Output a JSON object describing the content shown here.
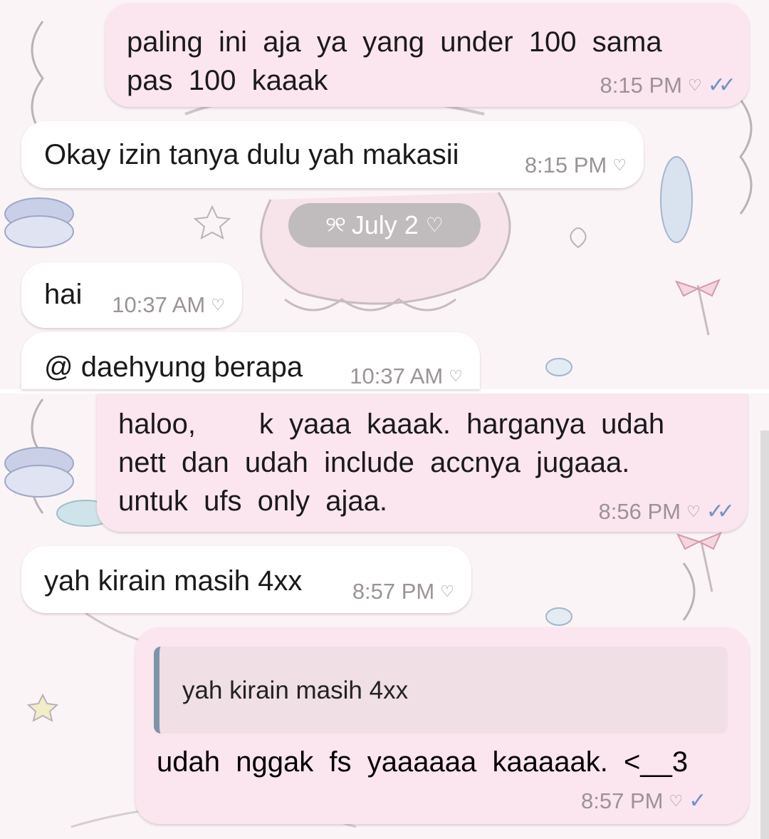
{
  "date_chip": {
    "text": "July 2",
    "deco": "୨୧"
  },
  "messages": [
    {
      "id": "m1",
      "direction": "outgoing",
      "lines": [
        "paling  ini  aja  ya  yang  under  100  sama",
        "pas  100  kaaak"
      ],
      "time": "8:15 PM",
      "status": "read"
    },
    {
      "id": "m2",
      "direction": "incoming",
      "lines": [
        "Okay izin tanya dulu yah makasii"
      ],
      "time": "8:15 PM"
    },
    {
      "id": "m3",
      "direction": "incoming",
      "lines": [
        "hai"
      ],
      "time": "10:37 AM"
    },
    {
      "id": "m4",
      "direction": "incoming",
      "lines": [
        "@ daehyung berapa"
      ],
      "time": "10:37 AM"
    },
    {
      "id": "m5",
      "direction": "outgoing",
      "lines": [
        "haloo,        k  yaaa  kaaak.  harganya  udah",
        "nett  dan  udah  include  accnya  jugaaa.",
        "untuk  ufs  only  ajaa."
      ],
      "time": "8:56 PM",
      "status": "read"
    },
    {
      "id": "m6",
      "direction": "incoming",
      "lines": [
        "yah kirain masih 4xx"
      ],
      "time": "8:57 PM"
    },
    {
      "id": "m7",
      "direction": "outgoing",
      "reply_to": "yah kirain masih 4xx",
      "lines": [
        "udah  nggak  fs  yaaaaaa  kaaaaak.  <__3"
      ],
      "time": "8:57 PM",
      "status": "sent"
    }
  ],
  "icons": {
    "heart": "heart-outline-icon",
    "read": "double-check-icon",
    "sent": "single-check-icon"
  },
  "colors": {
    "incoming_bubble": "#ffffff",
    "outgoing_bubble": "#fbe5ee",
    "tick_blue": "#6e93c4",
    "meta_gray": "#9b9396",
    "reply_bar": "#7d95a8"
  }
}
